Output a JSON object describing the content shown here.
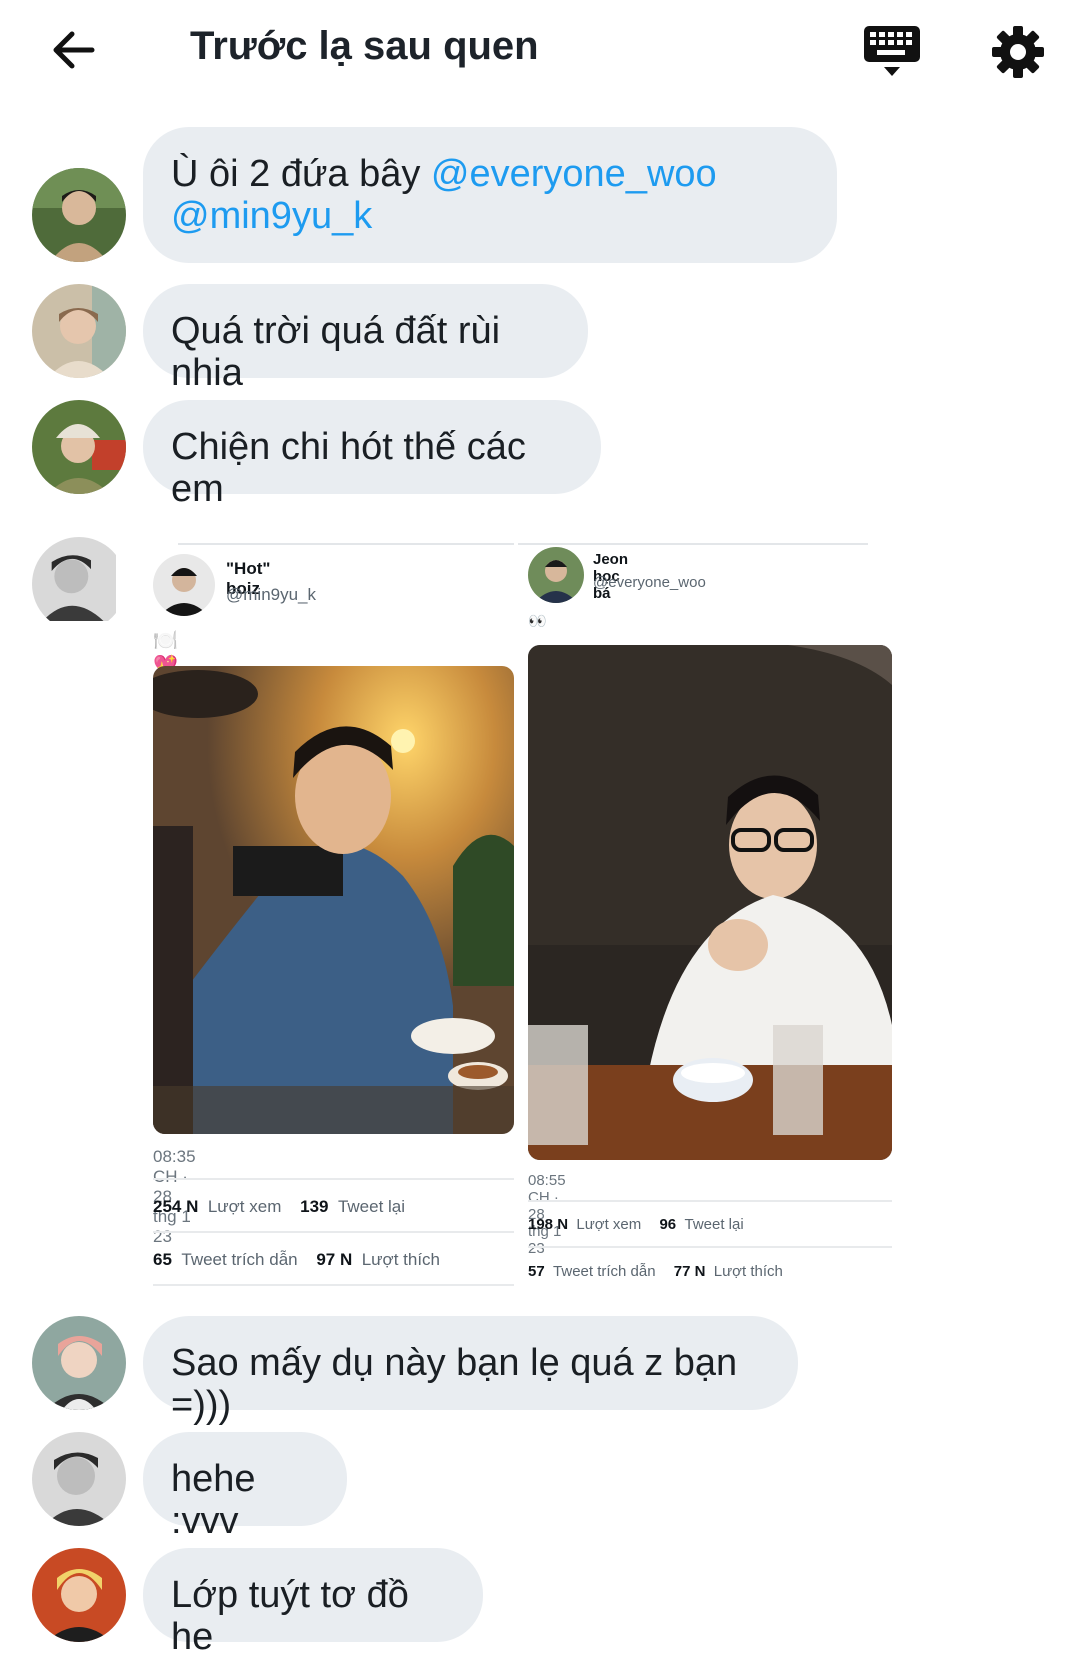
{
  "header": {
    "title": "Trước lạ sau quen",
    "back_icon": "arrow-left-icon",
    "keyboard_icon": "keyboard-hide-icon",
    "settings_icon": "gear-icon"
  },
  "messages": [
    {
      "text": "Ù ôi 2 đứa bây ",
      "mention1": "@everyone_woo",
      "mention2": "@min9yu_k"
    },
    {
      "text": "Quá trời quá đất rùi nhia"
    },
    {
      "text": "Chiện chi hót thế các em"
    },
    {
      "text": "Sao mấy dụ này bạn lẹ quá z bạn =)))"
    },
    {
      "text": "hehe :vvv"
    },
    {
      "text": "Lớp tuýt tơ đồ he"
    }
  ],
  "tweets": [
    {
      "name": "\"Hot\" boiz",
      "handle": "@min9yu_k",
      "emoji": "🍽️💖",
      "time": "08:35 CH · 28 thg 1 23",
      "views_num": "254 N",
      "views_label": "Lượt xem",
      "retweets_num": "139",
      "retweets_label": "Tweet lại",
      "quotes_num": "65",
      "quotes_label": "Tweet trích dẫn",
      "likes_num": "97 N",
      "likes_label": "Lượt thích"
    },
    {
      "name": "Jeon học bá",
      "handle": "@everyone_woo",
      "emoji": "👀",
      "time": "08:55 CH · 28 thg 1 23",
      "views_num": "198 N",
      "views_label": "Lượt xem",
      "retweets_num": "96",
      "retweets_label": "Tweet lại",
      "quotes_num": "57",
      "quotes_label": "Tweet trích dẫn",
      "likes_num": "77 N",
      "likes_label": "Lượt thích"
    }
  ],
  "colors": {
    "bubble": "#e9edf1",
    "mention": "#1d9bf0",
    "text": "#1a1f24"
  }
}
